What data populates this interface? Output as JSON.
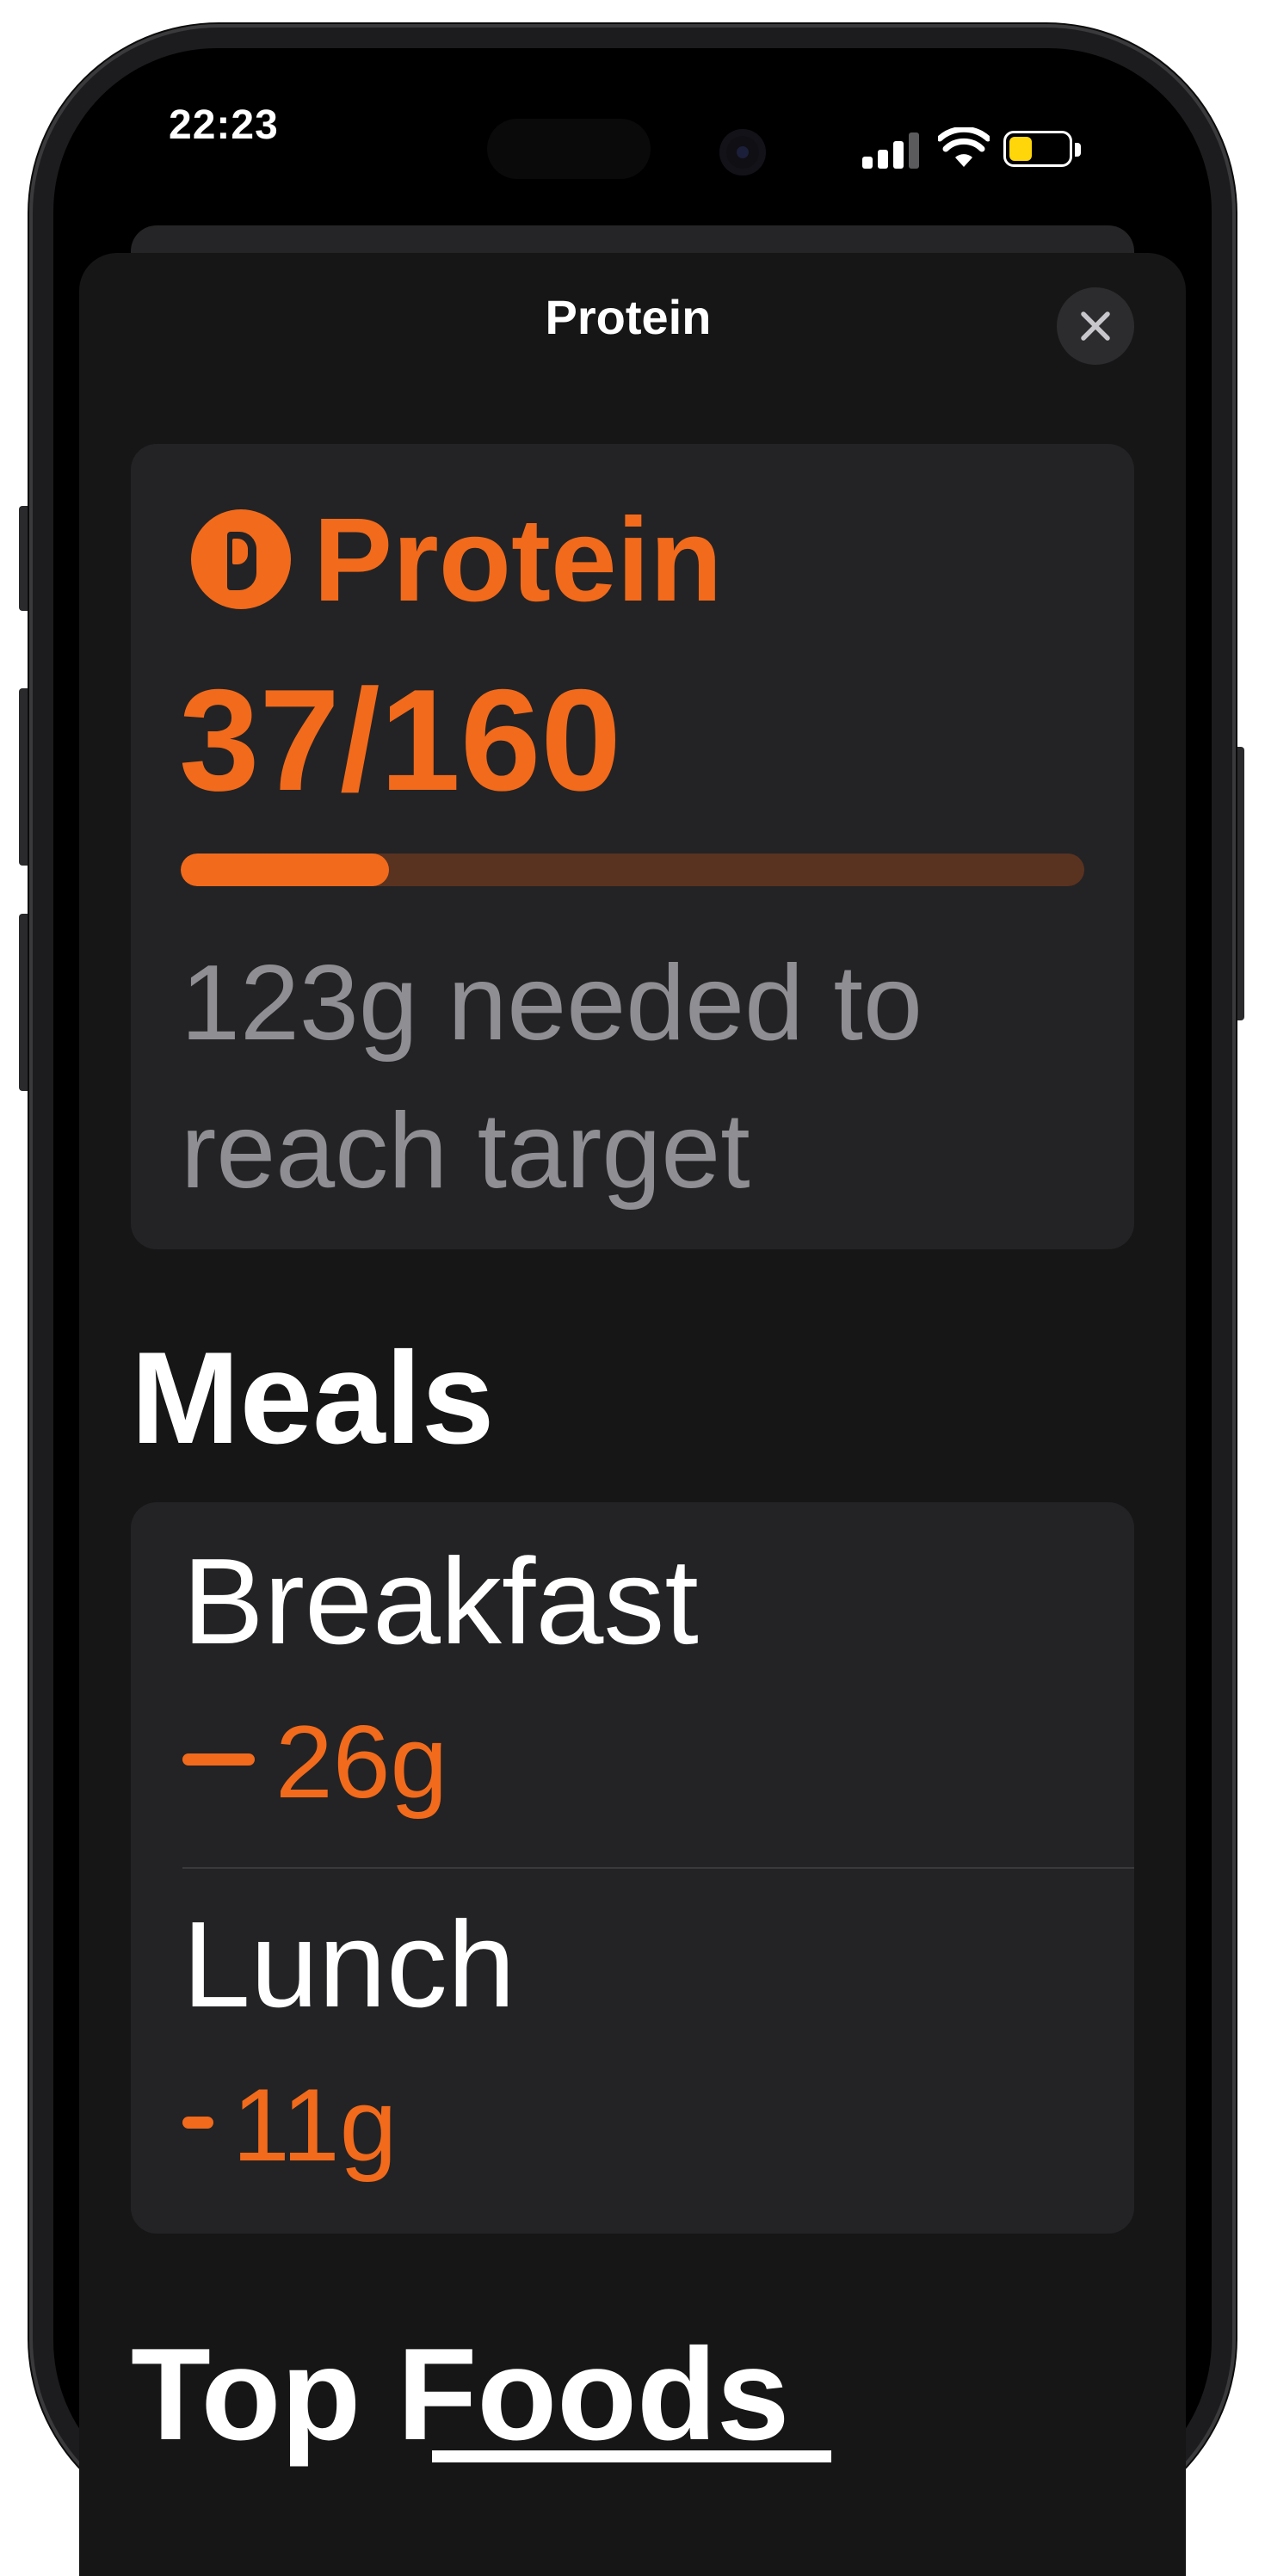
{
  "status_bar": {
    "time": "22:23",
    "signal_bars": 3,
    "signal_bars_total": 4,
    "battery_level": 0.3,
    "battery_color": "#ffd60a"
  },
  "sheet": {
    "title": "Protein",
    "close_icon": "close-icon"
  },
  "protein_card": {
    "icon": "protein-icon",
    "label": "Protein",
    "value": "37/160",
    "progress": 0.23,
    "remaining_text": "123g needed to reach target"
  },
  "meals": {
    "section_title": "Meals",
    "items": [
      {
        "name": "Breakfast",
        "value": "26g"
      },
      {
        "name": "Lunch",
        "value": "11g"
      }
    ]
  },
  "top_foods": {
    "section_title": "Top Foods"
  },
  "colors": {
    "accent": "#f26a1b",
    "track": "#5a3220",
    "card": "#232325",
    "secondary_text": "#8e8e93"
  }
}
